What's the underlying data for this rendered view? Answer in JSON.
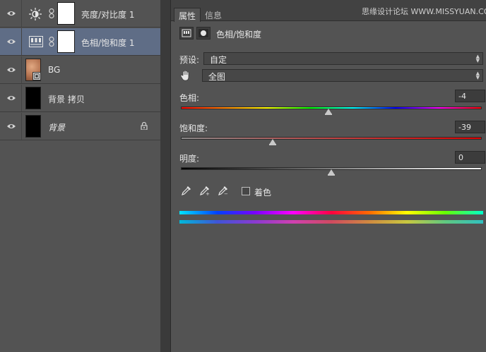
{
  "layers": [
    {
      "name": "亮度/对比度 1",
      "type": "adjustment",
      "icon": "brightness-sun-icon",
      "selected": false
    },
    {
      "name": "色相/饱和度 1",
      "type": "adjustment",
      "icon": "hue-saturation-icon",
      "selected": true
    },
    {
      "name": "BG",
      "type": "smart-object",
      "icon": "image-thumbnail",
      "selected": false
    },
    {
      "name": "背景 拷贝",
      "type": "pixel",
      "icon": "black-thumbnail",
      "selected": false
    },
    {
      "name": "背景",
      "type": "pixel",
      "icon": "black-thumbnail",
      "selected": false,
      "locked": true
    }
  ],
  "properties": {
    "tabs": [
      "属性",
      "信息"
    ],
    "watermark": "思缘设计论坛 WWW.MISSYUAN.COM",
    "title": "色相/饱和度",
    "preset_label": "预设:",
    "preset_value": "自定",
    "channel_value": "全图",
    "hue_label": "色相:",
    "hue_value": "-4",
    "hue_fraction": 0.49,
    "saturation_label": "饱和度:",
    "saturation_value": "-39",
    "saturation_fraction": 0.305,
    "lightness_label": "明度:",
    "lightness_value": "0",
    "lightness_fraction": 0.5,
    "colorize_label": "着色",
    "colorize_checked": false
  },
  "colors": {
    "panel_bg": "#535353",
    "selected_row": "#5f6d86",
    "tab_bar": "#424242"
  }
}
